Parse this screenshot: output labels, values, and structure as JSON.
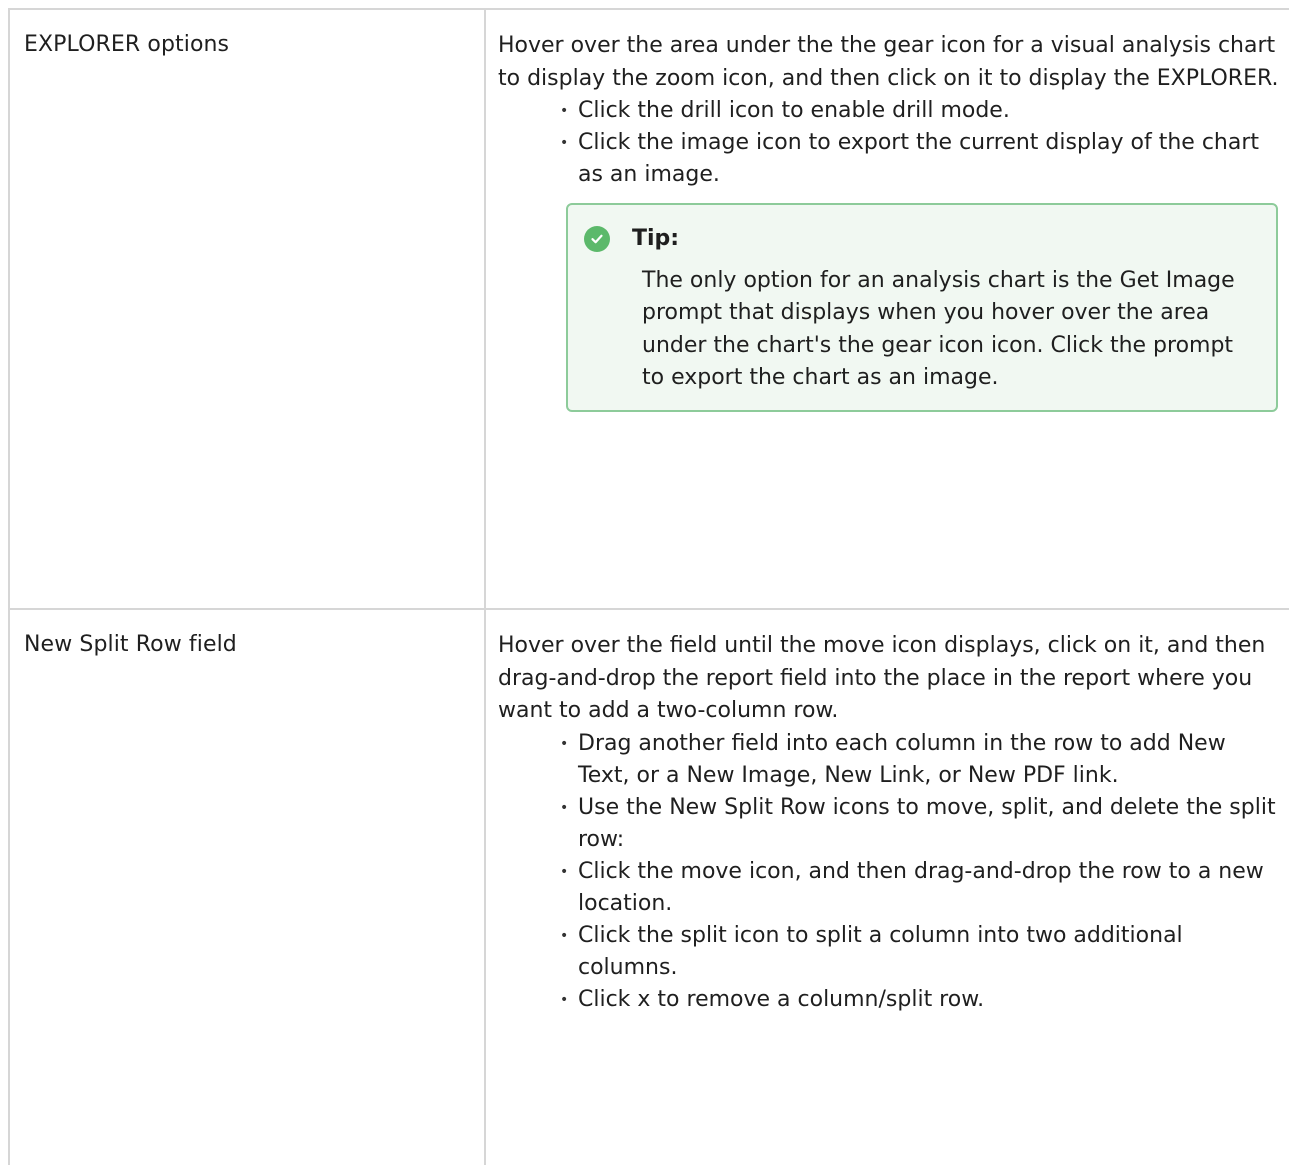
{
  "rows": [
    {
      "term": "EXPLORER options",
      "description": "Hover over the area under the the gear icon for a visual analysis chart to display the zoom icon, and then click on it to display the EXPLORER.",
      "bullets": [
        "Click the drill icon to enable drill mode.",
        "Click the image icon to export the current display of the chart as an image."
      ],
      "tip": {
        "title": "Tip:",
        "icon": "check-circle-icon",
        "text": "The only option for an analysis chart is the Get Image prompt that displays when you hover over the area under the chart's the gear icon icon. Click the prompt to export the chart as an image."
      }
    },
    {
      "term": "New Split Row field",
      "description": "Hover over the field until the move icon displays, click on it, and then drag-and-drop the report field into the place in the report where you want to add a two-column row.",
      "bullets": [
        "Drag another field into each column in the row to add New Text, or a New Image, New Link, or New PDF link.",
        "Use the New Split Row icons to move, split, and delete the split row:",
        "Click the move icon, and then drag-and-drop the row to a new location.",
        "Click the split icon to split a column into two additional columns.",
        "Click x to remove a column/split row."
      ]
    }
  ],
  "colors": {
    "border": "#d6d6d6",
    "tip_border": "#8dcb9a",
    "tip_background": "#f1f8f2",
    "tip_icon": "#5cb96b"
  }
}
